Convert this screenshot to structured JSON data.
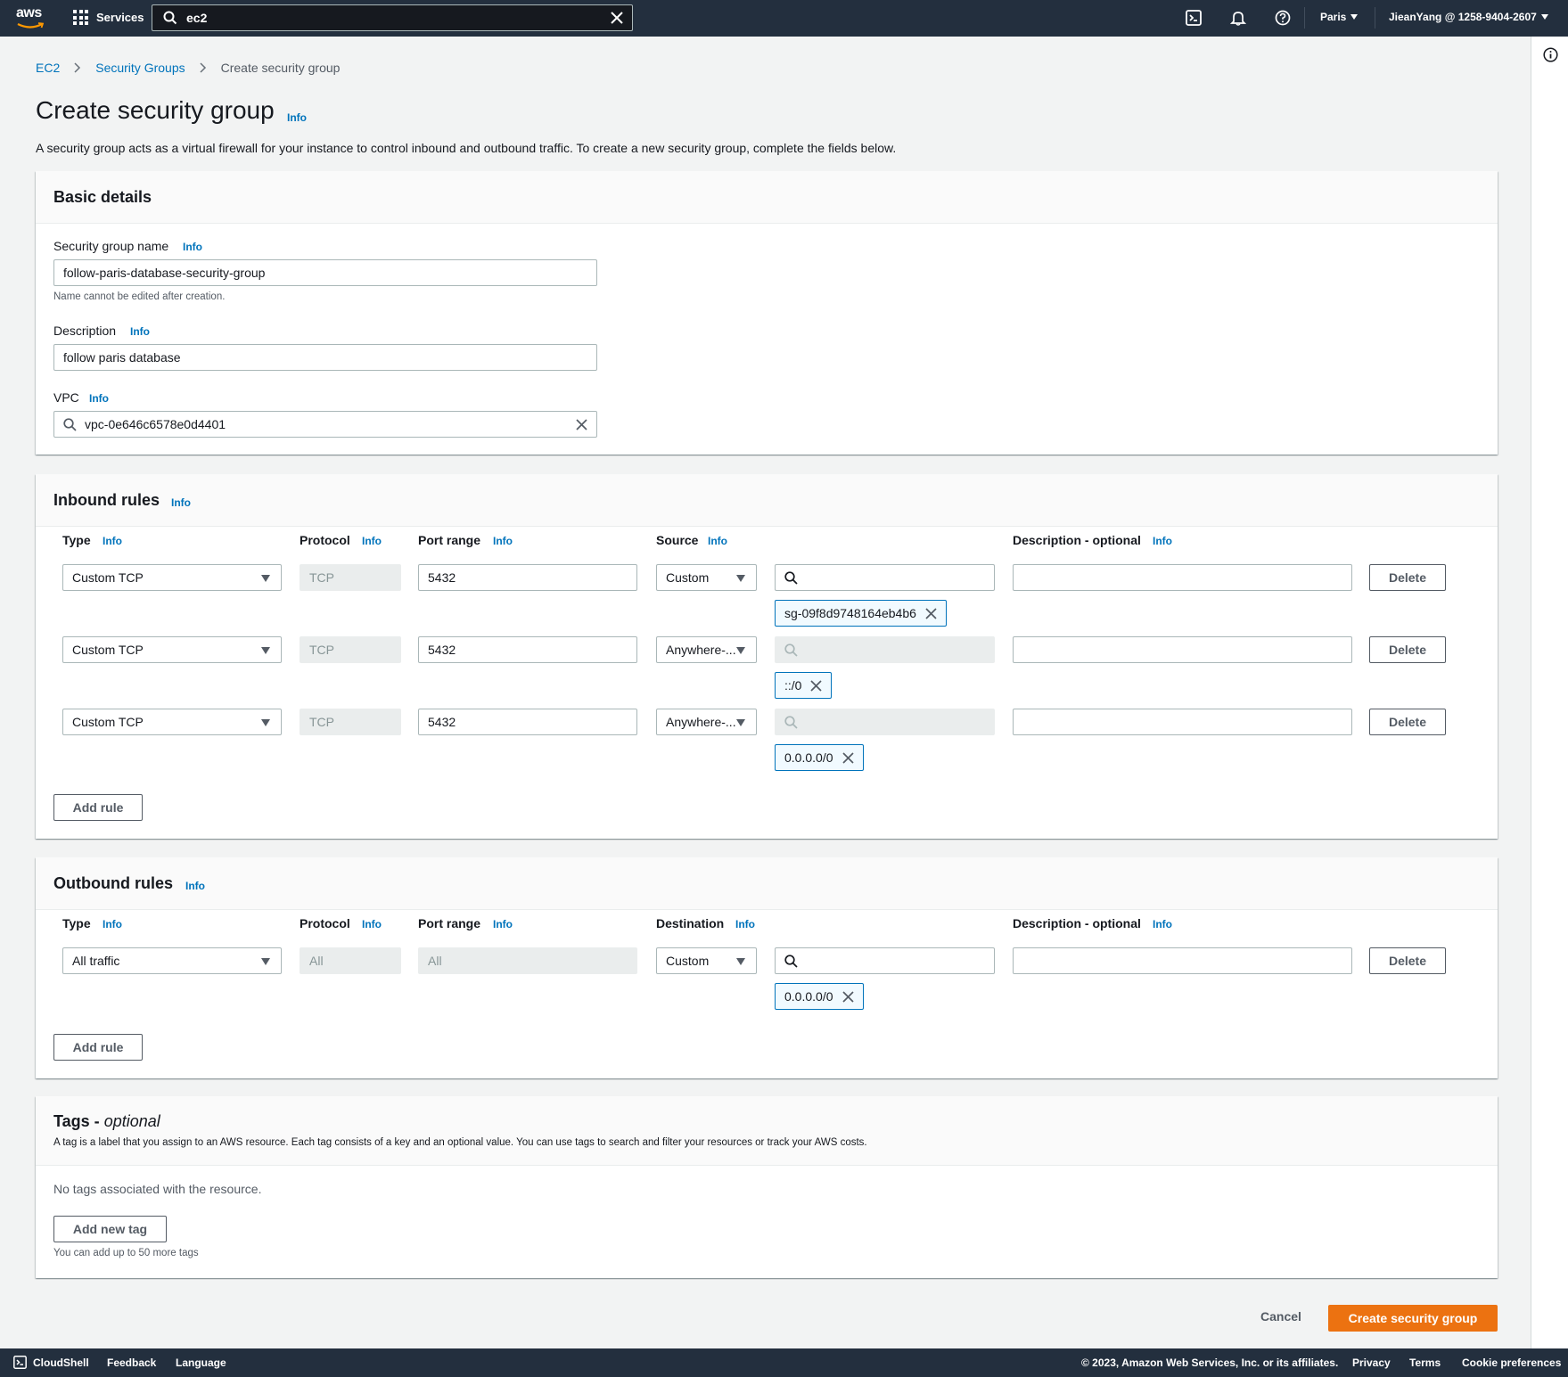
{
  "topnav": {
    "logo_text": "aws",
    "services_label": "Services",
    "search_value": "ec2",
    "region": "Paris",
    "account": "JieanYang @ 1258-9404-2607"
  },
  "breadcrumb": {
    "items": [
      "EC2",
      "Security Groups"
    ],
    "current": "Create security group"
  },
  "page": {
    "title": "Create security group",
    "title_info": "Info",
    "description": "A security group acts as a virtual firewall for your instance to control inbound and outbound traffic. To create a new security group, complete the fields below."
  },
  "basic_details": {
    "title": "Basic details",
    "name_label": "Security group name",
    "name_info": "Info",
    "name_value": "follow-paris-database-security-group",
    "name_hint": "Name cannot be edited after creation.",
    "desc_label": "Description",
    "desc_info": "Info",
    "desc_value": "follow paris database",
    "vpc_label": "VPC",
    "vpc_info": "Info",
    "vpc_value": "vpc-0e646c6578e0d4401"
  },
  "inbound": {
    "title": "Inbound rules",
    "title_info": "Info",
    "headers": {
      "type": "Type",
      "protocol": "Protocol",
      "port_range": "Port range",
      "source": "Source",
      "description": "Description - optional",
      "info": "Info"
    },
    "rules": [
      {
        "type": "Custom TCP",
        "protocol": "TCP",
        "port": "5432",
        "source": "Custom",
        "token": "sg-09f8d9748164eb4b6",
        "description": ""
      },
      {
        "type": "Custom TCP",
        "protocol": "TCP",
        "port": "5432",
        "source": "Anywhere-...",
        "token": "::/0",
        "description": ""
      },
      {
        "type": "Custom TCP",
        "protocol": "TCP",
        "port": "5432",
        "source": "Anywhere-...",
        "token": "0.0.0.0/0",
        "description": ""
      }
    ],
    "delete_label": "Delete",
    "add_rule_label": "Add rule"
  },
  "outbound": {
    "title": "Outbound rules",
    "title_info": "Info",
    "headers": {
      "type": "Type",
      "protocol": "Protocol",
      "port_range": "Port range",
      "destination": "Destination",
      "description": "Description - optional",
      "info": "Info"
    },
    "rules": [
      {
        "type": "All traffic",
        "protocol": "All",
        "port": "All",
        "destination": "Custom",
        "token": "0.0.0.0/0",
        "description": ""
      }
    ],
    "delete_label": "Delete",
    "add_rule_label": "Add rule"
  },
  "tags": {
    "title": "Tags -",
    "title_optional": "optional",
    "description": "A tag is a label that you assign to an AWS resource. Each tag consists of a key and an optional value. You can use tags to search and filter your resources or track your AWS costs.",
    "empty_text": "No tags associated with the resource.",
    "add_tag_label": "Add new tag",
    "limit_hint": "You can add up to 50 more tags"
  },
  "actions": {
    "cancel_label": "Cancel",
    "create_label": "Create security group"
  },
  "footer": {
    "cloudshell": "CloudShell",
    "feedback": "Feedback",
    "language": "Language",
    "copyright": "© 2023, Amazon Web Services, Inc. or its affiliates.",
    "privacy": "Privacy",
    "terms": "Terms",
    "cookie": "Cookie preferences"
  },
  "colors": {
    "nav_bg": "#232f3e",
    "link": "#0073bb",
    "primary": "#ec7211",
    "token_border": "#0073bb",
    "token_bg": "#f1faff"
  }
}
